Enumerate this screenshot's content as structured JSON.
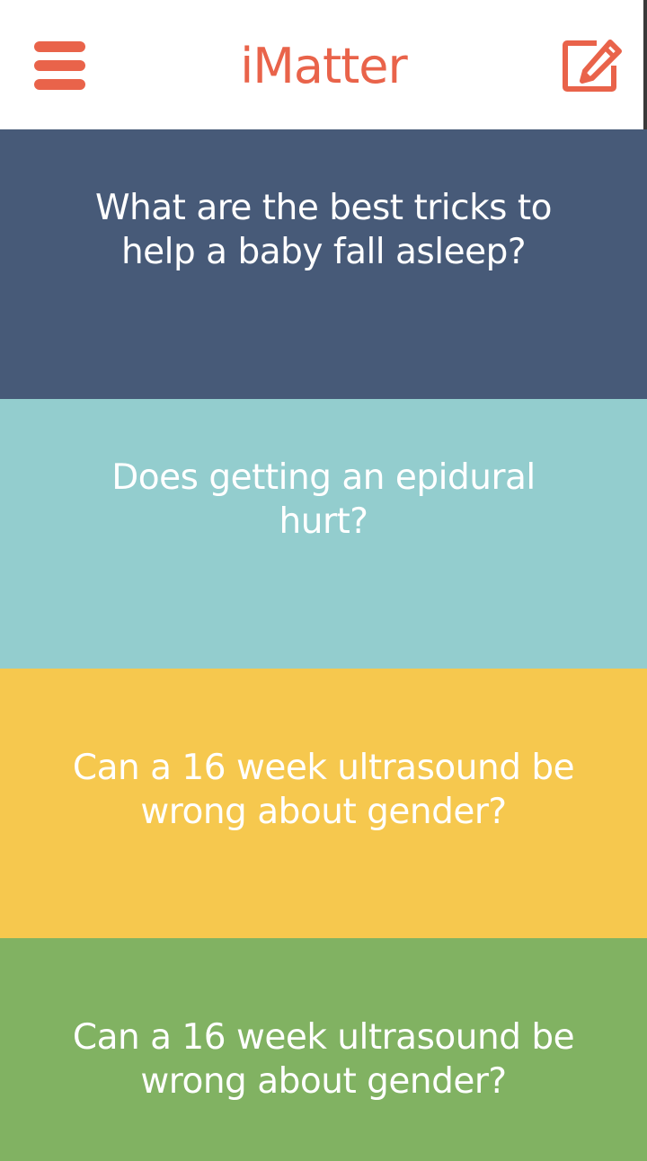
{
  "app": {
    "title": "iMatter",
    "accent_color": "#e9634a"
  },
  "header": {
    "menu_icon": "hamburger-menu-icon",
    "compose_icon": "edit-square-pencil-icon"
  },
  "questions": [
    {
      "text": "What are the best tricks to help a baby fall asleep?",
      "color": "#475a78"
    },
    {
      "text": "Does getting an epidural hurt?",
      "color": "#93cdce"
    },
    {
      "text": "Can a 16 week ultrasound be wrong about gender?",
      "color": "#f6c84e"
    },
    {
      "text": "Can a 16 week ultrasound be wrong about gender?",
      "color": "#81b262"
    }
  ]
}
